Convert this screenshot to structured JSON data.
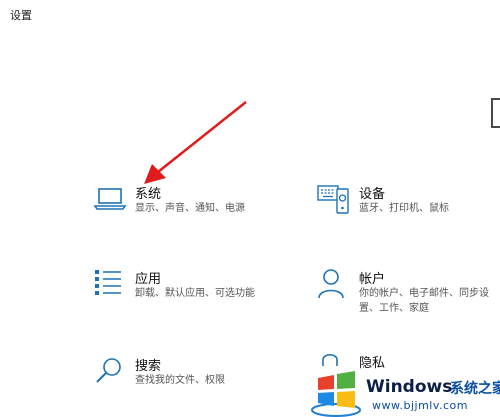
{
  "window": {
    "title": "设置"
  },
  "tiles": [
    {
      "id": "system",
      "name": "系统",
      "desc": "显示、声音、通知、电源",
      "icon": "laptop-icon"
    },
    {
      "id": "devices",
      "name": "设备",
      "desc": "蓝牙、打印机、鼠标",
      "icon": "keyboard-icon"
    },
    {
      "id": "apps",
      "name": "应用",
      "desc": "卸载、默认应用、可选功能",
      "icon": "app-list-icon"
    },
    {
      "id": "accounts",
      "name": "帐户",
      "desc": "你的帐户、电子邮件、同步设置、工作、家庭",
      "icon": "person-icon"
    },
    {
      "id": "search",
      "name": "搜索",
      "desc": "查找我的文件、权限",
      "icon": "magnifier-icon"
    },
    {
      "id": "privacy",
      "name": "隐私",
      "desc": "",
      "icon": "lock-icon"
    }
  ],
  "colors": {
    "accent": "#1d73b8",
    "annotation": "#e11b1b"
  },
  "watermark": {
    "brand": "Windows",
    "brand_suffix": "系统之家",
    "url": "www.bjjmlv.com"
  }
}
